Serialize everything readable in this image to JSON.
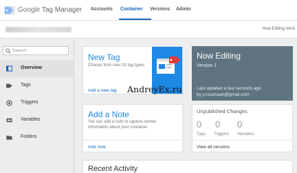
{
  "header": {
    "brand_google": "Google",
    "brand_product": "Tag Manager",
    "nav": [
      "Accounts",
      "Container",
      "Versions",
      "Admin"
    ],
    "active_nav": "Container",
    "accent_color": "#1565c0"
  },
  "subbar": {
    "status": "Now Editing Versi"
  },
  "sidebar": {
    "search_placeholder": "Search",
    "items": [
      {
        "label": "Overview",
        "icon": "overview-icon",
        "active": true
      },
      {
        "label": "Tags",
        "icon": "tag-icon",
        "active": false
      },
      {
        "label": "Triggers",
        "icon": "trigger-icon",
        "active": false
      },
      {
        "label": "Variables",
        "icon": "variables-icon",
        "active": false
      },
      {
        "label": "Folders",
        "icon": "folder-icon",
        "active": false
      }
    ]
  },
  "new_tag": {
    "title": "New Tag",
    "description": "Choose from over 20 tag types",
    "link": "Add a new tag"
  },
  "watermark": "AndreyEx.ru",
  "add_note": {
    "title": "Add a Note",
    "description": "You can add a note to capture certain information about your container.",
    "link": "Add note"
  },
  "now_editing": {
    "title": "Now Editing",
    "version": "Version 1",
    "updated": "Last updated a few seconds ago",
    "by": "by y.noumaan@gmail.com",
    "background_color": "#5f7480"
  },
  "unpublished": {
    "title": "Unpublished Changes",
    "stats": [
      {
        "value": "0",
        "label": "Tags"
      },
      {
        "value": "0",
        "label": "Triggers"
      },
      {
        "value": "0",
        "label": "Variables"
      }
    ],
    "link": "View all versions"
  },
  "recent_activity": {
    "title": "Recent Activity"
  }
}
